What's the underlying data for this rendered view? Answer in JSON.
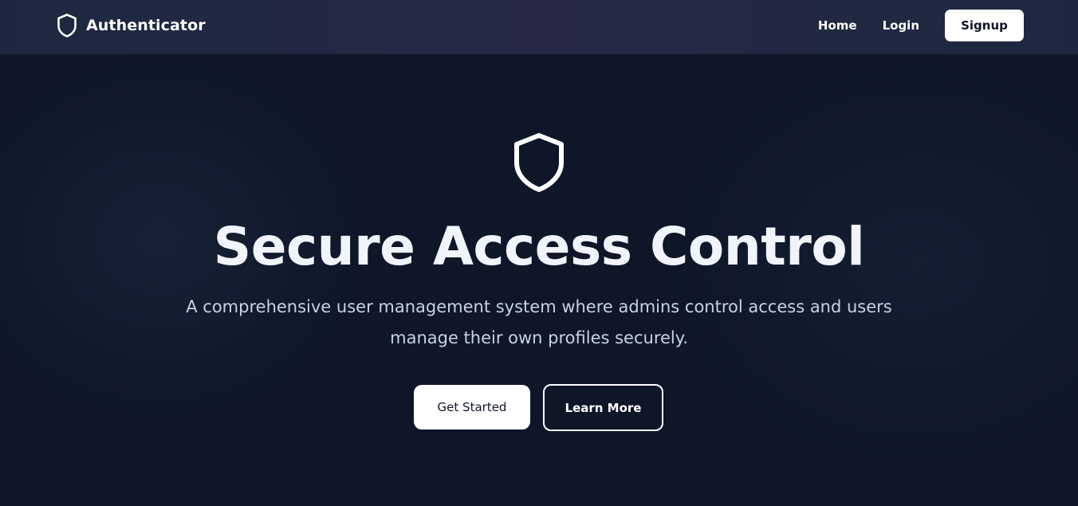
{
  "brand": {
    "name": "Authenticator",
    "icon": "shield-icon"
  },
  "nav": {
    "home": "Home",
    "login": "Login",
    "signup": "Signup"
  },
  "hero": {
    "icon": "shield-icon",
    "title": "Secure Access Control",
    "subtitle": "A comprehensive user management system where admins control access and users manage their own profiles securely.",
    "primary_cta": "Get Started",
    "secondary_cta": "Learn More"
  },
  "colors": {
    "background": "#0e1628",
    "navbar": "#1d2840",
    "text": "#ffffff",
    "subtitle": "#c9d2e1"
  }
}
